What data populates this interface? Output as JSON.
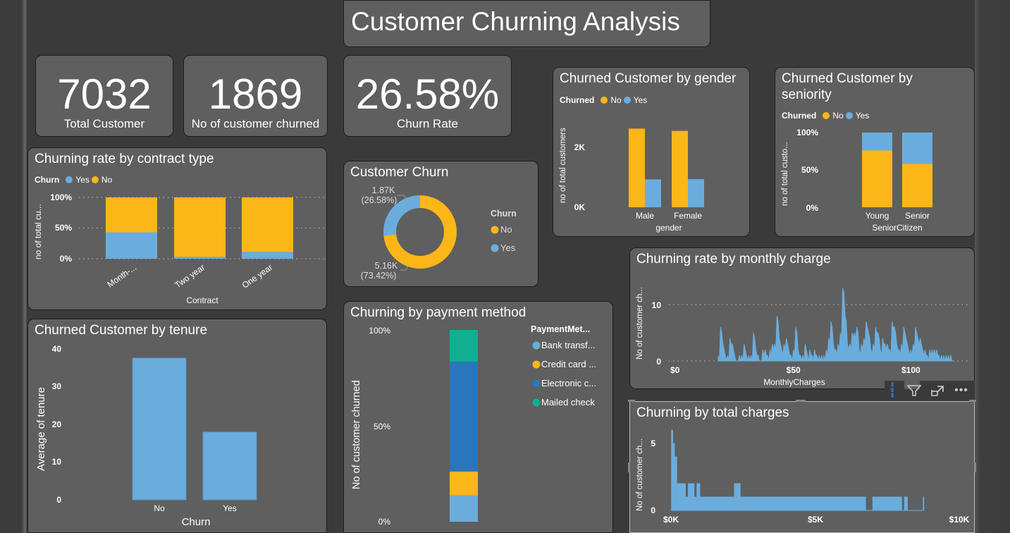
{
  "title": "Customer Churning Analysis",
  "colors": {
    "yes": "#6aaddd",
    "no": "#fbb617",
    "bank": "#6aaddd",
    "credit": "#fbb617",
    "electronic": "#2a76bd",
    "mailed": "#10af91"
  },
  "kpis": [
    {
      "value": "7032",
      "label": "Total Customer"
    },
    {
      "value": "1869",
      "label": "No of customer churned"
    },
    {
      "value": "26.58%",
      "label": "Churn Rate"
    }
  ],
  "contract": {
    "title": "Churning rate by contract type",
    "legend_title": "Churn",
    "legend": [
      "Yes",
      "No"
    ],
    "ylabel": "no of total cu...",
    "xlabel": "Contract",
    "yticks": [
      "100%",
      "50%",
      "0%"
    ]
  },
  "donut": {
    "title": "Customer Churn",
    "legend_title": "Churn",
    "legend": [
      "No",
      "Yes"
    ],
    "label_yes_1": "1.87K",
    "label_yes_2": "(26.58%)",
    "label_no_1": "5.16K",
    "label_no_2": "(73.42%)"
  },
  "gender": {
    "title": "Churned Customer by gender",
    "legend_title": "Churned",
    "legend": [
      "No",
      "Yes"
    ],
    "ylabel": "no of total customers",
    "xlabel": "gender",
    "yticks": [
      "2K",
      "0K"
    ]
  },
  "seniority": {
    "title_1": "Churned Customer by",
    "title_2": "seniority",
    "legend_title": "Churned",
    "legend": [
      "No",
      "Yes"
    ],
    "ylabel": "no of total custo...",
    "xlabel": "SeniorCitizen",
    "yticks": [
      "100%",
      "50%",
      "0%"
    ]
  },
  "monthly": {
    "title": "Churning rate by monthly charge",
    "ylabel": "No of customer ch...",
    "xlabel": "MonthlyCharges",
    "yticks": [
      "10",
      "0"
    ],
    "xticks": [
      "$0",
      "$50",
      "$100"
    ]
  },
  "tenure": {
    "title": "Churned Customer by tenure",
    "ylabel": "Average of tenure",
    "xlabel": "Churn",
    "yticks": [
      "40",
      "30",
      "20",
      "10",
      "0"
    ]
  },
  "payment": {
    "title": "Churning by payment method",
    "legend_title": "PaymentMet...",
    "legend": [
      "Bank transf...",
      "Credit card ...",
      "Electronic c...",
      "Mailed check"
    ],
    "ylabel": "No of customer churned",
    "yticks": [
      "100%",
      "50%",
      "0%"
    ]
  },
  "total": {
    "title": "Churning by total charges",
    "ylabel": "No of customer ch...",
    "yticks": [
      "5",
      "0"
    ],
    "xticks": [
      "$0K",
      "$5K",
      "$10K"
    ]
  },
  "toolbar": {
    "info": "i",
    "filter": "filter",
    "expand": "focus mode",
    "more": "..."
  },
  "chart_data": [
    {
      "type": "bar",
      "stacked_percent": true,
      "title": "Churning rate by contract type",
      "categories": [
        "Month-...",
        "Two year",
        "One year"
      ],
      "series": [
        {
          "name": "Yes",
          "values": [
            43,
            3,
            11
          ]
        },
        {
          "name": "No",
          "values": [
            57,
            97,
            89
          ]
        }
      ],
      "xlabel": "Contract",
      "ylabel": "no of total cu...",
      "ylim": [
        0,
        100
      ]
    },
    {
      "type": "pie",
      "donut": true,
      "title": "Customer Churn",
      "categories": [
        "No",
        "Yes"
      ],
      "values": [
        5163,
        1869
      ],
      "percents": [
        73.42,
        26.58
      ]
    },
    {
      "type": "bar",
      "title": "Churned Customer by gender",
      "categories": [
        "Male",
        "Female"
      ],
      "series": [
        {
          "name": "No",
          "values": [
            2625,
            2549
          ]
        },
        {
          "name": "Yes",
          "values": [
            930,
            939
          ]
        }
      ],
      "xlabel": "gender",
      "ylabel": "no of total customers",
      "ylim": [
        0,
        3000
      ]
    },
    {
      "type": "bar",
      "stacked_percent": true,
      "title": "Churned Customer by seniority",
      "categories": [
        "Young",
        "Senior"
      ],
      "series": [
        {
          "name": "No",
          "values": [
            76,
            58
          ]
        },
        {
          "name": "Yes",
          "values": [
            24,
            42
          ]
        }
      ],
      "xlabel": "SeniorCitizen",
      "ylabel": "no of total custo...",
      "ylim": [
        0,
        100
      ]
    },
    {
      "type": "area",
      "title": "Churning rate by monthly charge",
      "xlabel": "MonthlyCharges",
      "ylabel": "No of customer ch...",
      "xlim": [
        0,
        120
      ],
      "ylim": [
        0,
        13
      ],
      "x": [
        18,
        19,
        20,
        21,
        22,
        23,
        24,
        25,
        26,
        27,
        28,
        29,
        30,
        31,
        32,
        33,
        34,
        35,
        36,
        37,
        38,
        39,
        40,
        41,
        42,
        43,
        44,
        45,
        46,
        47,
        48,
        49,
        50,
        51,
        52,
        53,
        54,
        55,
        56,
        57,
        58,
        59,
        60,
        61,
        62,
        63,
        64,
        65,
        66,
        67,
        68,
        69,
        70,
        71,
        72,
        73,
        74,
        75,
        76,
        77,
        78,
        79,
        80,
        81,
        82,
        83,
        84,
        85,
        86,
        87,
        88,
        89,
        90,
        91,
        92,
        93,
        94,
        95,
        96,
        97,
        98,
        99,
        100,
        101,
        102,
        103,
        104,
        105,
        106,
        107,
        108,
        109,
        110,
        111,
        112,
        113,
        114,
        115,
        116,
        117,
        118
      ],
      "y": [
        1,
        6,
        3,
        1,
        1,
        4,
        3,
        1,
        0,
        1,
        1,
        3,
        1,
        1,
        1,
        5,
        2,
        1,
        0,
        2,
        2,
        1,
        2,
        3,
        3,
        8,
        4,
        2,
        3,
        4,
        2,
        1,
        2,
        6,
        2,
        1,
        1,
        3,
        1,
        2,
        1,
        2,
        1,
        1,
        1,
        1,
        2,
        4,
        7,
        3,
        2,
        3,
        5,
        13,
        8,
        3,
        3,
        5,
        5,
        6,
        2,
        3,
        4,
        7,
        5,
        2,
        3,
        6,
        5,
        2,
        4,
        3,
        3,
        2,
        7,
        6,
        3,
        2,
        3,
        6,
        4,
        2,
        2,
        3,
        6,
        4,
        4,
        2,
        2,
        1,
        2,
        2,
        2,
        2,
        1,
        1,
        1,
        1,
        1,
        1,
        0
      ]
    },
    {
      "type": "bar",
      "title": "Churned Customer by tenure",
      "categories": [
        "No",
        "Yes"
      ],
      "values": [
        37.6,
        18.0
      ],
      "xlabel": "Churn",
      "ylabel": "Average of tenure",
      "ylim": [
        0,
        40
      ]
    },
    {
      "type": "bar",
      "stacked_percent": true,
      "title": "Churning by payment method",
      "categories": [
        ""
      ],
      "series": [
        {
          "name": "Bank transfer",
          "values": [
            13.8
          ]
        },
        {
          "name": "Credit card",
          "values": [
            12.4
          ]
        },
        {
          "name": "Electronic check",
          "values": [
            57.3
          ]
        },
        {
          "name": "Mailed check",
          "values": [
            16.5
          ]
        }
      ],
      "ylabel": "No of customer churned",
      "ylim": [
        0,
        100
      ]
    },
    {
      "type": "area",
      "title": "Churning by total charges",
      "ylabel": "No of customer ch...",
      "xlim": [
        0,
        10000
      ],
      "ylim": [
        0,
        6
      ],
      "x": [
        18,
        60,
        120,
        200,
        300,
        400,
        500,
        600,
        700,
        800,
        900,
        1000,
        1200,
        1500,
        1800,
        2200,
        2300,
        2400,
        2600,
        3000,
        4000,
        5000,
        6000,
        6700,
        6750,
        7000,
        7900,
        8000,
        8100,
        8200,
        8300,
        8700,
        8750
      ],
      "y": [
        6,
        5,
        4,
        2,
        2,
        2,
        1,
        2,
        2,
        1,
        2,
        1,
        1,
        1,
        1,
        2,
        2,
        1,
        1,
        1,
        1,
        1,
        1,
        1,
        0,
        1,
        1,
        0,
        1,
        0,
        0,
        0,
        1
      ]
    }
  ]
}
